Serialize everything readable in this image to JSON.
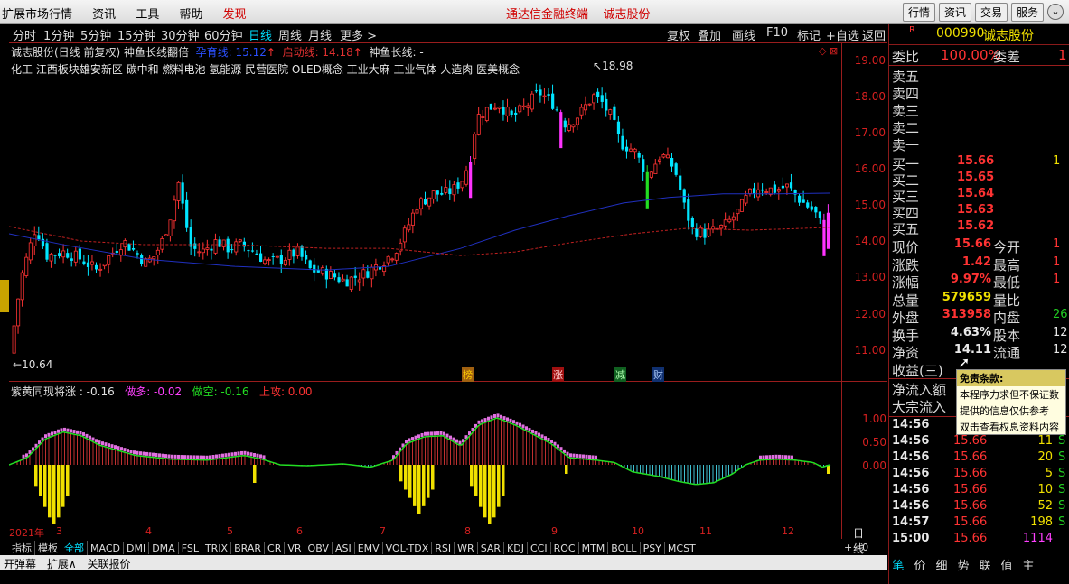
{
  "topbar": {
    "menus": [
      "扩展市场行情",
      "资讯",
      "工具",
      "帮助"
    ],
    "discover": "发现",
    "center_app": "通达信金融终端",
    "center_stock": "诚志股份",
    "right_buttons": [
      "行情",
      "资讯",
      "交易",
      "服务"
    ]
  },
  "toolbar": {
    "periods": [
      "分时",
      "1分钟",
      "5分钟",
      "15分钟",
      "30分钟",
      "60分钟",
      "日线",
      "周线",
      "月线",
      "更多 >"
    ],
    "active_period": "日线",
    "right_items": [
      "复权",
      "叠加",
      "画线",
      "F10",
      "标记",
      "+自选",
      "返回"
    ]
  },
  "chart_header": {
    "title": "诚志股份(日线 前复权) 神鱼长线翻倍",
    "ind1_label": "孕育线: 15.12",
    "ind2_label": "启动线: 14.18",
    "ind3_label": "神鱼长线: -",
    "concepts": "化工    江西板块雄安新区 碳中和 燃料电池 氢能源 民营医院 OLED概念 工业大麻 工业气体 人造肉 医美概念"
  },
  "price_axis": {
    "labels": [
      "19.00",
      "18.00",
      "17.00",
      "16.00",
      "15.00",
      "14.00",
      "13.00",
      "12.00",
      "11.00"
    ],
    "high_marker": "18.98",
    "low_marker": "10.64"
  },
  "event_tags": [
    "榜",
    "涨",
    "减",
    "财"
  ],
  "indicator_panel": {
    "header_name": "紫黄同现将涨 : -0.16",
    "zuoduo": "做多: -0.02",
    "zuokong": "做空: -0.16",
    "shanggong": "上攻: 0.00",
    "axis_labels": [
      "1.00",
      "0.50",
      "0.00"
    ]
  },
  "x_axis": {
    "labels": [
      "2021年",
      "3",
      "4",
      "5",
      "6",
      "7",
      "8",
      "9",
      "10",
      "11",
      "12"
    ],
    "period_label": "日线"
  },
  "indicator_tabs": [
    "指标",
    "模板",
    "全部",
    "MACD",
    "DMI",
    "DMA",
    "FSL",
    "TRIX",
    "BRAR",
    "CR",
    "VR",
    "OBV",
    "ASI",
    "EMV",
    "VOL-TDX",
    "RSI",
    "WR",
    "SAR",
    "KDJ",
    "CCI",
    "ROC",
    "MTM",
    "BOLL",
    "PSY",
    "MCST"
  ],
  "active_indicator_tab": "全部",
  "bottombar": {
    "items": [
      "开弹幕",
      "扩展∧",
      "关联报价"
    ]
  },
  "quote_panel": {
    "code": "000990",
    "name": "诚志股份",
    "weibi_label": "委比",
    "weibi_value": "100.00%",
    "weicha_label": "委差",
    "weicha_value": "1",
    "sell_labels": [
      "卖五",
      "卖四",
      "卖三",
      "卖二",
      "卖一"
    ],
    "buy_levels": [
      {
        "label": "买一",
        "price": "15.66",
        "vol": "1"
      },
      {
        "label": "买二",
        "price": "15.65",
        "vol": ""
      },
      {
        "label": "买三",
        "price": "15.64",
        "vol": ""
      },
      {
        "label": "买四",
        "price": "15.63",
        "vol": ""
      },
      {
        "label": "买五",
        "price": "15.62",
        "vol": ""
      }
    ],
    "stats": [
      {
        "l1": "现价",
        "v1": "15.66",
        "l2": "今开",
        "v2": "1"
      },
      {
        "l1": "涨跌",
        "v1": "1.42",
        "l2": "最高",
        "v2": "1"
      },
      {
        "l1": "涨幅",
        "v1": "9.97%",
        "l2": "最低",
        "v2": "1"
      },
      {
        "l1": "总量",
        "v1": "579659",
        "l2": "量比",
        "v2": ""
      },
      {
        "l1": "外盘",
        "v1": "313958",
        "l2": "内盘",
        "v2": "26"
      },
      {
        "l1": "换手",
        "v1": "4.63%",
        "l2": "股本",
        "v2": "12"
      },
      {
        "l1": "净资",
        "v1": "14.11",
        "l2": "流通",
        "v2": "12"
      },
      {
        "l1": "收益(三)",
        "v1": "",
        "l2": "",
        "v2": ""
      }
    ],
    "flow_labels": [
      "净流入额",
      "大宗流入"
    ],
    "ticks": [
      {
        "time": "14:56",
        "price": "",
        "vol": "",
        "dir": ""
      },
      {
        "time": "14:56",
        "price": "15.66",
        "vol": "11",
        "dir": "S"
      },
      {
        "time": "14:56",
        "price": "15.66",
        "vol": "20",
        "dir": "S"
      },
      {
        "time": "14:56",
        "price": "15.66",
        "vol": "5",
        "dir": "S"
      },
      {
        "time": "14:56",
        "price": "15.66",
        "vol": "10",
        "dir": "S"
      },
      {
        "time": "14:56",
        "price": "15.66",
        "vol": "52",
        "dir": "S"
      },
      {
        "time": "14:57",
        "price": "15.66",
        "vol": "198",
        "dir": "S"
      },
      {
        "time": "15:00",
        "price": "15.66",
        "vol": "1114",
        "dir": ""
      }
    ],
    "bottom_tabs": [
      "笔",
      "价",
      "细",
      "势",
      "联",
      "值",
      "主"
    ]
  },
  "tooltip": {
    "title": "免责条款:",
    "lines": [
      "本程序力求但不保证数",
      "提供的信息仅供参考",
      "双击查看权息资料内容"
    ]
  },
  "colors": {
    "up": "#ff3333",
    "down": "#00e5ff",
    "ma_blue": "#2030c0",
    "ma_red": "#c02020",
    "highlight_magenta": "#ff33ff",
    "highlight_green": "#22dd22"
  }
}
